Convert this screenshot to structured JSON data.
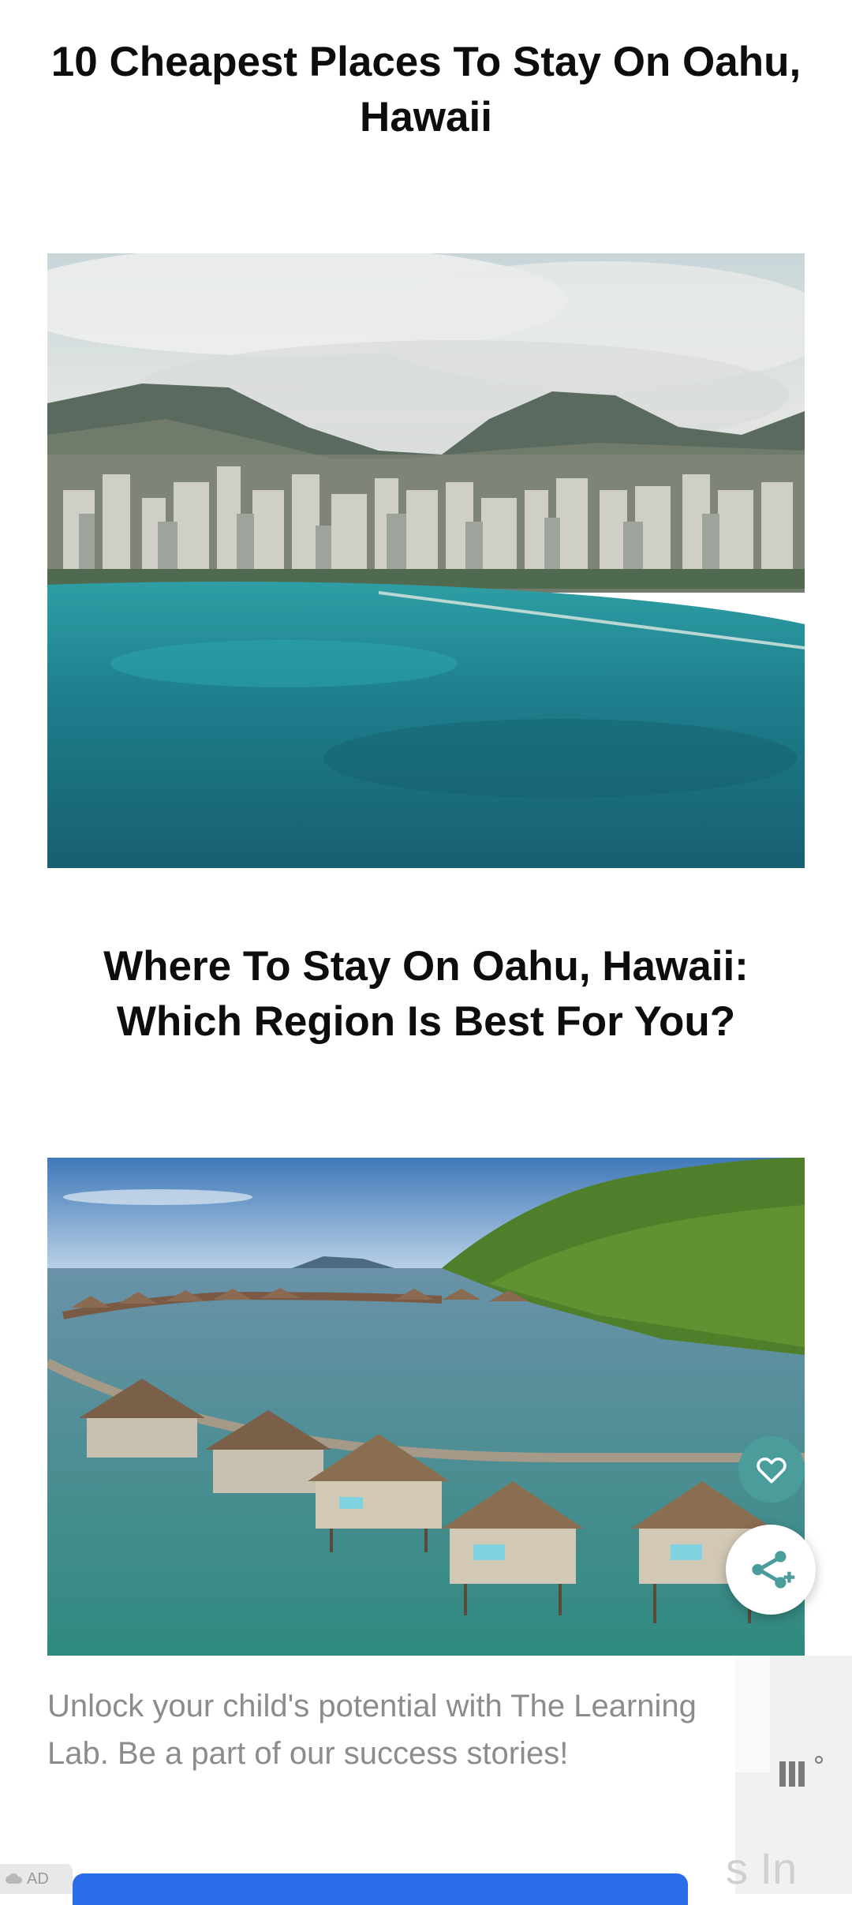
{
  "article": {
    "headline_1": "10 Cheapest Places To Stay On Oahu, Hawaii",
    "headline_2": "Where To Stay On Oahu, Hawaii: Which Region Is Best For You?"
  },
  "icons": {
    "heart": "heart-icon",
    "share": "share-icon"
  },
  "ad": {
    "text": "Unlock your child's potential with The Learning Lab. Be a part of our success stories!",
    "badge": "AD",
    "edge_text": "s In"
  },
  "colors": {
    "fab_heart": "#4a9d9a",
    "cta": "#2b6de8",
    "ad_text": "#8c8c8c"
  }
}
